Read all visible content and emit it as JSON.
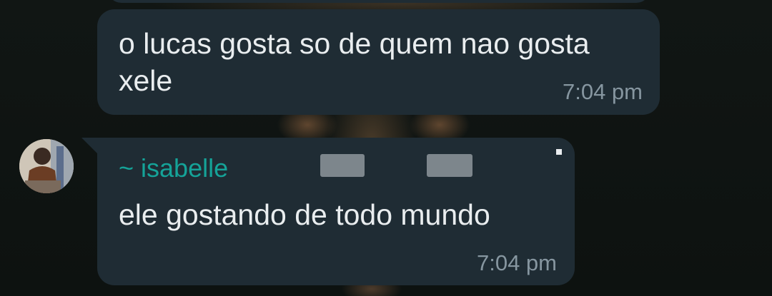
{
  "chat": {
    "messages": [
      {
        "text": "o lucas gosta so de quem nao gosta xele",
        "time": "7:04 pm"
      },
      {
        "sender": "~ isabelle",
        "text": "ele gostando de todo mundo",
        "time": "7:04 pm"
      }
    ]
  },
  "colors": {
    "background": "#0f1412",
    "bubble": "#1f2c34",
    "text": "#e9edef",
    "timestamp": "#8696a0",
    "sender": "#15a398"
  }
}
